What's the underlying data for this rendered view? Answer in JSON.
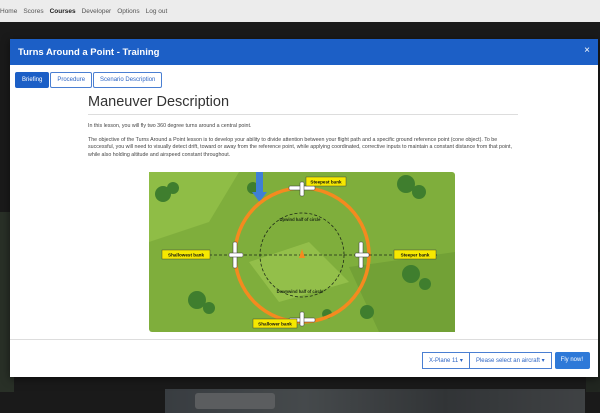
{
  "nav": {
    "items": [
      "Home",
      "Scores",
      "Courses",
      "Developer",
      "Options",
      "Log out"
    ],
    "active": "Courses"
  },
  "modal": {
    "title": "Turns Around a Point - Training",
    "close_glyph": "×",
    "tabs": [
      {
        "label": "Briefing",
        "active": true
      },
      {
        "label": "Procedure",
        "active": false
      },
      {
        "label": "Scenario Description",
        "active": false
      }
    ],
    "heading": "Maneuver Description",
    "paragraphs": [
      "In this lesson, you will fly two 360 degree turns around a central point.",
      "The objective of the Turns Around a Point lesson is to develop your ability to divide attention between your flight path and a specific ground reference point (cone object). To be successful, you will need to visually detect drift, toward or away from the reference point, while applying coordinated, corrective inputs to maintain a constant distance from that point, while also holding altitude and airspeed constant throughout."
    ],
    "diagram": {
      "labels": {
        "steepest": "Steepest bank",
        "shallowest": "Shallowest bank",
        "steeper": "Steeper bank",
        "shallower": "Shallower bank",
        "upwind": "Upwind half of circle",
        "downwind": "Downwind half of circle"
      },
      "colors": {
        "grass": "#7fae3c",
        "circle": "#f58a1f",
        "label_bg": "#f6e800",
        "wind": "#3f7fd6"
      }
    },
    "footer": {
      "sim_label": "X-Plane 11 ▾",
      "aircraft_label": "Please select an aircraft ▾",
      "fly_label": "Fly now!"
    }
  }
}
